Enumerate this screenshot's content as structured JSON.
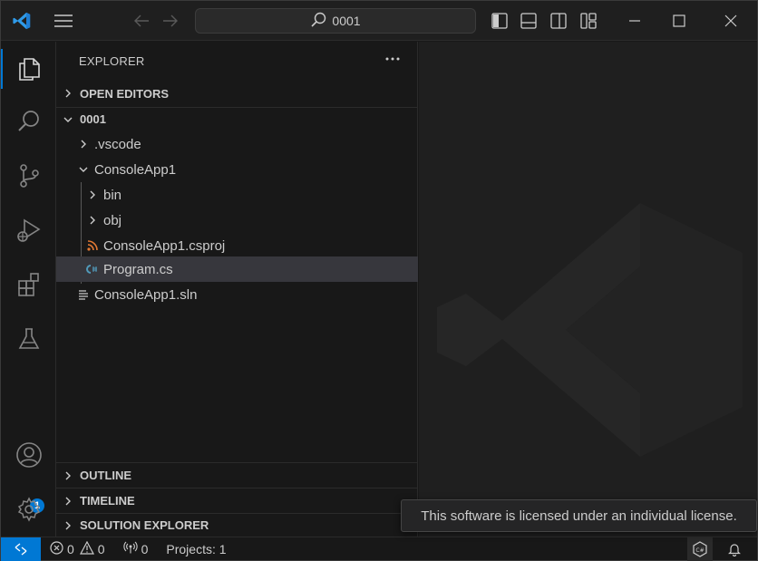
{
  "titlebar": {
    "search_text": "0001"
  },
  "activity_bar": {
    "accounts_badge": "1"
  },
  "sidebar": {
    "header": "EXPLORER",
    "open_editors": "OPEN EDITORS",
    "folder": "0001",
    "tree": [
      {
        "label": ".vscode",
        "type": "folder-collapsed"
      },
      {
        "label": "ConsoleApp1",
        "type": "folder-expanded"
      },
      {
        "label": "bin",
        "type": "folder-collapsed"
      },
      {
        "label": "obj",
        "type": "folder-collapsed"
      },
      {
        "label": "ConsoleApp1.csproj",
        "type": "rss-icon"
      },
      {
        "label": "Program.cs",
        "type": "csharp-icon"
      },
      {
        "label": "ConsoleApp1.sln",
        "type": "lines-icon"
      }
    ],
    "outline": "OUTLINE",
    "timeline": "TIMELINE",
    "solution_explorer": "SOLUTION EXPLORER"
  },
  "statusbar": {
    "errors": "0",
    "warnings": "0",
    "ports": "0",
    "projects": "Projects: 1"
  },
  "tooltip": "This software is licensed under an individual license.",
  "colors": {
    "accent": "#0078d4",
    "rss": "#e37933",
    "csharp": "#519aba"
  }
}
